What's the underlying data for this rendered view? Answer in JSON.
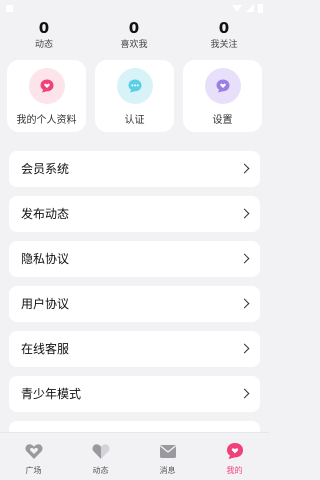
{
  "stats": [
    {
      "value": "0",
      "label": "动态"
    },
    {
      "value": "0",
      "label": "喜欢我"
    },
    {
      "value": "0",
      "label": "我关注"
    }
  ],
  "quick_actions": [
    {
      "label": "我的个人资料",
      "icon": "heart-bubble-icon",
      "bg": "#fde3ea",
      "color": "#f0417a"
    },
    {
      "label": "认证",
      "icon": "chat-dots-icon",
      "bg": "#d8f3f8",
      "color": "#5bcfe8"
    },
    {
      "label": "设置",
      "icon": "heart-bubble-icon",
      "bg": "#e8e0fb",
      "color": "#9b7fe8"
    }
  ],
  "menu": [
    {
      "label": "会员系统"
    },
    {
      "label": "发布动态"
    },
    {
      "label": "隐私协议"
    },
    {
      "label": "用户协议"
    },
    {
      "label": "在线客服"
    },
    {
      "label": "青少年模式"
    }
  ],
  "tabs": [
    {
      "label": "广场",
      "icon": "heart-icon"
    },
    {
      "label": "动态",
      "icon": "half-heart-icon"
    },
    {
      "label": "消息",
      "icon": "envelope-icon"
    },
    {
      "label": "我的",
      "icon": "heart-bubble-icon"
    }
  ],
  "colors": {
    "accent": "#f0417a",
    "page_bg": "#f2f2f4"
  }
}
